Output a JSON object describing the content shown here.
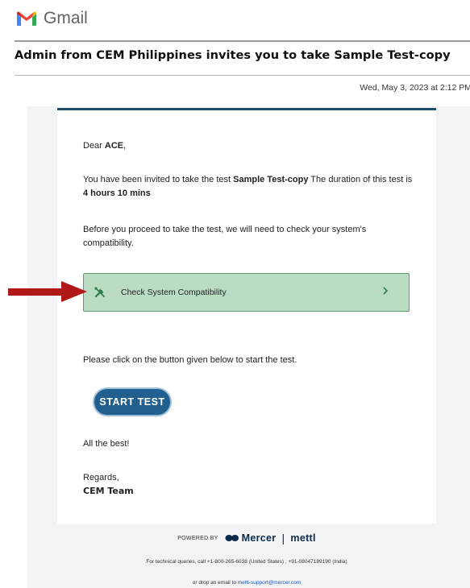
{
  "header": {
    "app_name": "Gmail",
    "brand_colors": {
      "red": "#ea4335",
      "blue": "#4285f4",
      "green": "#34a853",
      "yellow": "#fbbc04"
    }
  },
  "message": {
    "subject": "Admin from CEM Philippines invites you to take Sample Test-copy",
    "date": "Wed, May 3, 2023 at 2:12 PM"
  },
  "email": {
    "greeting_prefix": "Dear ",
    "recipient_name": "ACE",
    "greeting_suffix": ",",
    "invite_prefix": "You have been invited to take the test ",
    "test_name": "Sample Test-copy",
    "invite_middle": " The duration of this test is ",
    "duration": "4 hours 10 mins",
    "compat_text": "Before you proceed to take the test, we will need to check your system's compatibility.",
    "compat_button": {
      "label": "Check System Compatibility",
      "icon": "tools-icon",
      "chevron": "chevron-right-icon"
    },
    "start_instruction": "Please click on the button given below to start the test.",
    "start_button": "START TEST",
    "wish": "All the best!",
    "regards": "Regards,",
    "signature": "CEM Team"
  },
  "footer": {
    "powered_by": "POWERED BY",
    "mercer": "Mercer",
    "separator": "|",
    "mettl": "mettl",
    "support_line": "For technical queries, call +1-800-265-6038 (United States) , +91-08047189190 (India)",
    "email_prefix": "or drop an email to ",
    "support_email": "mettl-support@mercer.com"
  },
  "annotation": {
    "arrow_color": "#b01818"
  },
  "colors": {
    "accent": "#1f4e6e",
    "start_button": "#215f8e",
    "compat_bg": "#b9dcc3",
    "compat_border": "#5a9e6e"
  }
}
